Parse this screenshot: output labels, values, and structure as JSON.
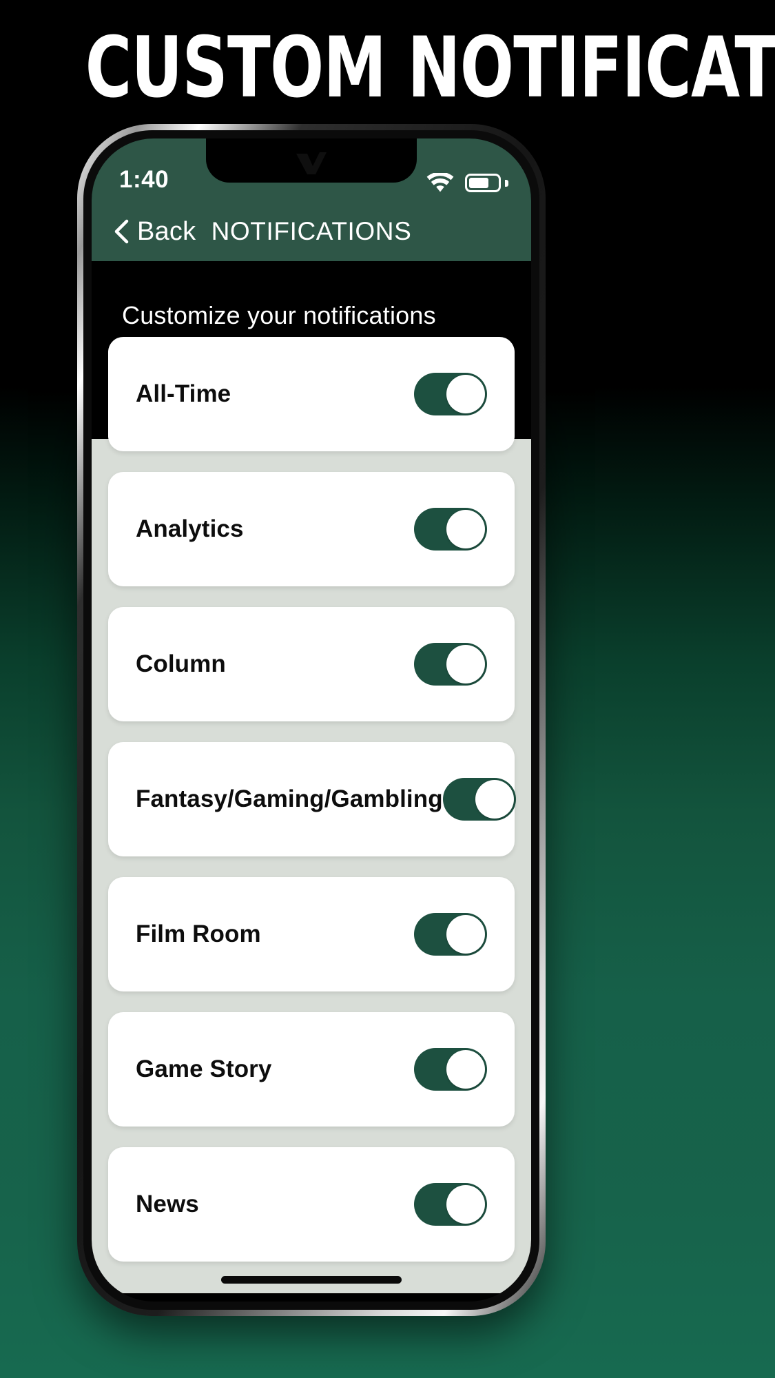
{
  "headline": "CUSTOM NOTIFICATIONS",
  "colors": {
    "brand_green": "#2e5647",
    "toggle_on_green": "#1d5040",
    "list_background": "#d8ddd7",
    "card_white": "#ffffff",
    "intro_background": "#000000",
    "page_gradient_top": "#000000",
    "page_gradient_bottom": "#176a50"
  },
  "phone": {
    "status_bar": {
      "time": "1:40",
      "wifi_icon": "wifi-icon",
      "battery_icon": "battery-icon",
      "battery_level": 60
    },
    "nav": {
      "back_icon": "chevron-left-icon",
      "back_label": "Back",
      "title": "NOTIFICATIONS"
    },
    "intro": {
      "text": "Customize your notifications"
    },
    "rows": [
      {
        "label": "All-Time",
        "enabled": true
      },
      {
        "label": "Analytics",
        "enabled": true
      },
      {
        "label": "Column",
        "enabled": true
      },
      {
        "label": "Fantasy/Gaming/Gambling",
        "enabled": true
      },
      {
        "label": "Film Room",
        "enabled": true
      },
      {
        "label": "Game Story",
        "enabled": true
      },
      {
        "label": "News",
        "enabled": true
      }
    ],
    "home_indicator": "home-indicator"
  }
}
